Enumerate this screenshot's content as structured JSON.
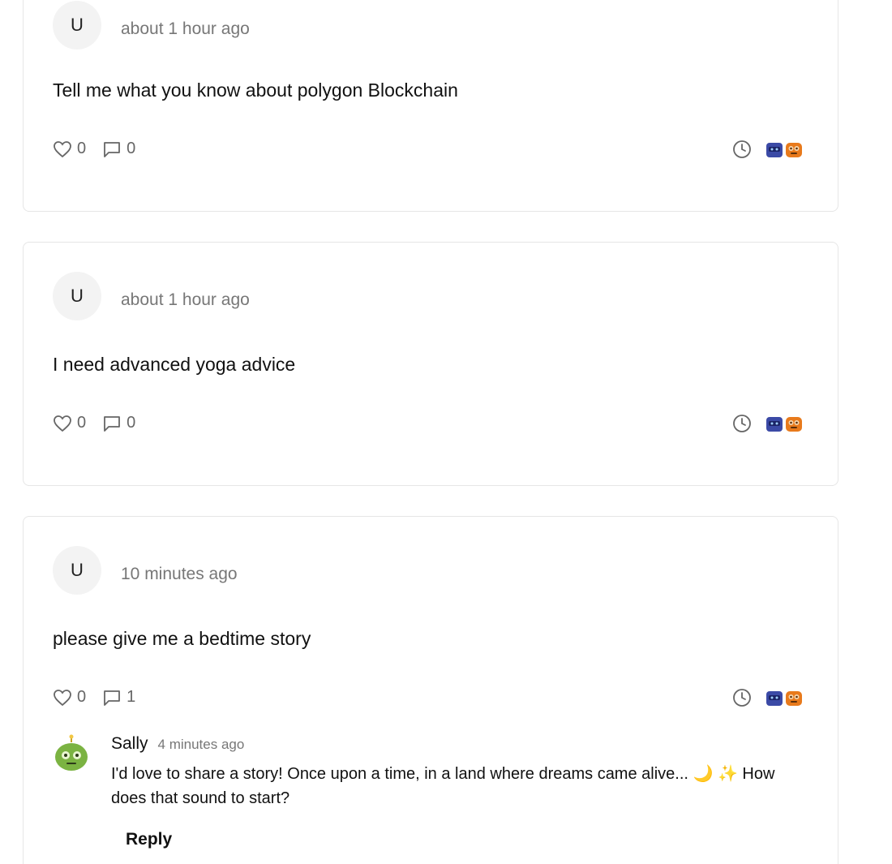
{
  "posts": [
    {
      "avatar_letter": "U",
      "timestamp": "about 1 hour ago",
      "text": "Tell me what you know about polygon Blockchain",
      "likes": "0",
      "comments": "0"
    },
    {
      "avatar_letter": "U",
      "timestamp": "about 1 hour ago",
      "text": "I need advanced yoga advice",
      "likes": "0",
      "comments": "0"
    },
    {
      "avatar_letter": "U",
      "timestamp": "10 minutes ago",
      "text": "please give me a bedtime story",
      "likes": "0",
      "comments": "1",
      "reply": {
        "author": "Sally",
        "timestamp": "4 minutes ago",
        "text": "I'd love to share a story! Once upon a time, in a land where dreams came alive... 🌙 ✨ How does that sound to start?",
        "reply_label": "Reply"
      }
    }
  ],
  "icons": {
    "like": "heart-icon",
    "comment": "comment-icon",
    "clock": "clock-icon",
    "bots": "bot-avatars-icon",
    "reply_avatar": "green-robot-icon"
  },
  "colors": {
    "border": "#e6e6e6",
    "muted_text": "#777777",
    "avatar_bg": "#f3f3f3",
    "bot_blue": "#3b4aa6",
    "bot_orange": "#e87a1c",
    "robot_green": "#7bb342"
  }
}
